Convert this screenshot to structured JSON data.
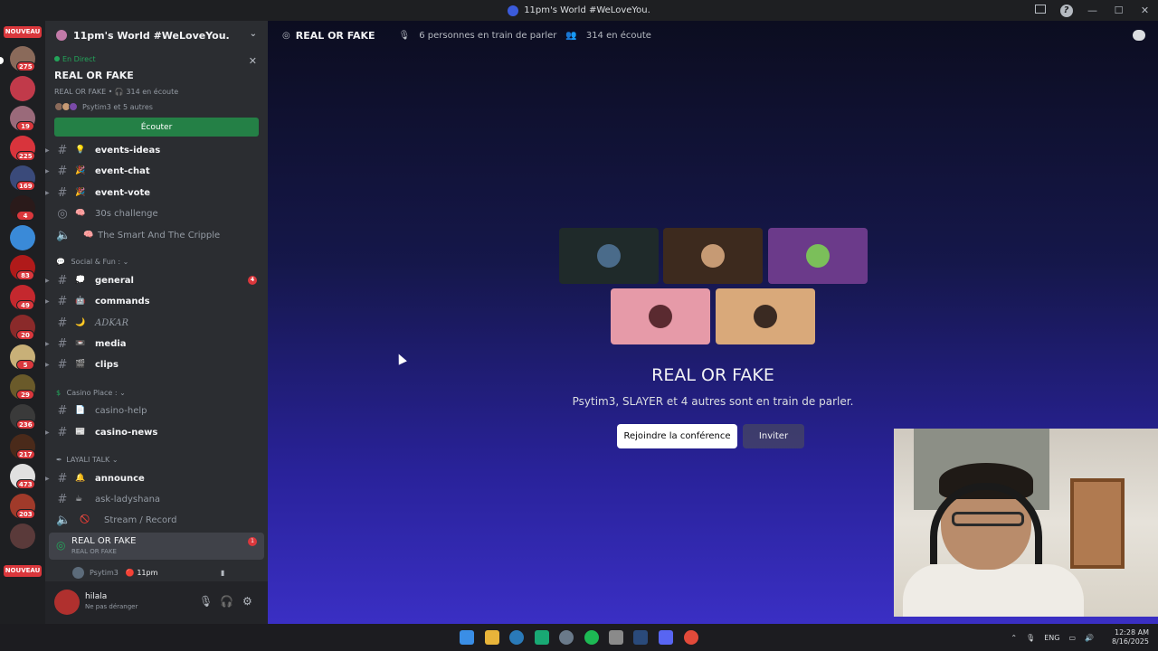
{
  "window": {
    "title": "11pm's World #WeLoveYou."
  },
  "rail": {
    "new_label": "NOUVEAU",
    "badges": [
      "275",
      "19",
      "225",
      "169",
      "4",
      "83",
      "49",
      "20",
      "5",
      "29",
      "236",
      "217",
      "473",
      "203"
    ]
  },
  "server": {
    "name": "11pm's World #WeLoveYou."
  },
  "live": {
    "status": "En Direct",
    "title": "REAL OR FAKE",
    "meta": "REAL OR FAKE • 🎧 314 en écoute",
    "speakers": "Psytim3 et 5 autres",
    "listen_button": "Écouter"
  },
  "channels": [
    {
      "emoji": "💡",
      "label": "events-ideas"
    },
    {
      "emoji": "🎉",
      "label": "event-chat"
    },
    {
      "emoji": "🎉",
      "label": "event-vote"
    },
    {
      "emoji": "🧠",
      "label": "30s challenge"
    },
    {
      "emoji": "🧠",
      "label": "The Smart And The Cripple"
    }
  ],
  "category_social": "Social & Fun :",
  "social_channels": [
    {
      "emoji": "💭",
      "label": "general",
      "badge": "4"
    },
    {
      "emoji": "🤖",
      "label": "commands"
    },
    {
      "emoji": "🌙",
      "label": "ADKAR"
    },
    {
      "emoji": "📼",
      "label": "media"
    },
    {
      "emoji": "🎬",
      "label": "clips"
    }
  ],
  "category_casino": "Casino Place :",
  "casino_channels": [
    {
      "emoji": "📄",
      "label": "casino-help"
    },
    {
      "emoji": "📰",
      "label": "casino-news"
    }
  ],
  "category_layali": "LAYALI TALK",
  "layali_channels": [
    {
      "emoji": "🔔",
      "label": "announce"
    },
    {
      "emoji": "☕",
      "label": "ask-ladyshana"
    },
    {
      "emoji": "🚫",
      "label": "Stream / Record"
    }
  ],
  "active_channel": {
    "label": "REAL OR FAKE",
    "sub": "REAL OR FAKE",
    "badge": "1"
  },
  "voice_user": {
    "name": "Psytim3",
    "tag": "11pm"
  },
  "user": {
    "name": "hilala",
    "status": "Ne pas déranger"
  },
  "header": {
    "title": "REAL OR FAKE",
    "speaking": "6 personnes en train de parler",
    "listening": "314 en écoute"
  },
  "stage": {
    "title": "REAL OR FAKE",
    "subtitle": "Psytim3, SLAYER et 4 autres sont en train de parler.",
    "join_button": "Rejoindre la conférence",
    "invite_button": "Inviter"
  },
  "tiles": [
    {
      "bg": "#1f2a2a",
      "av": "#4a6b8a"
    },
    {
      "bg": "#3d2a1e",
      "av": "#c69a74"
    },
    {
      "bg": "#6b3a8a",
      "av": "#7bbf5a"
    },
    {
      "bg": "#e69aa8",
      "av": "#5a2a30"
    },
    {
      "bg": "#d9a97a",
      "av": "#3a2a22"
    }
  ],
  "tray": {
    "lang": "ENG",
    "time": "12:28 AM",
    "date": "8/16/2025"
  }
}
